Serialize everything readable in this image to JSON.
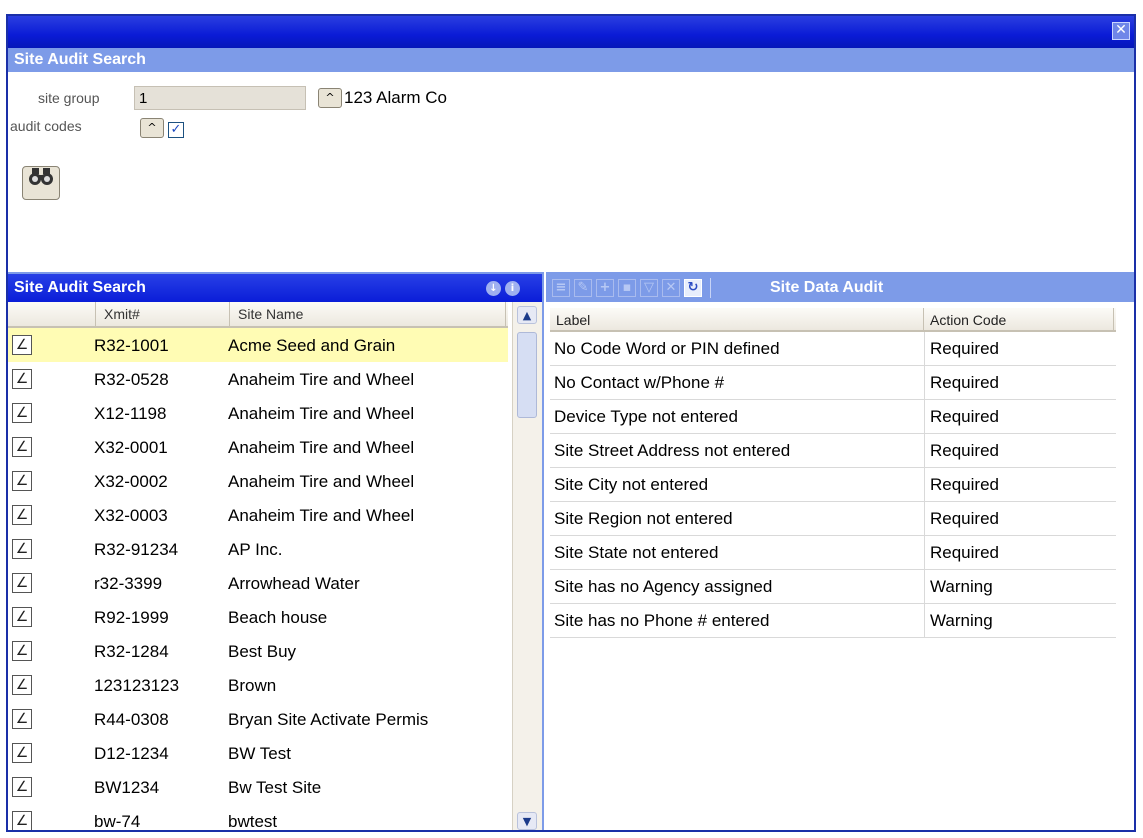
{
  "window": {
    "close_glyph": "✕"
  },
  "search_panel": {
    "title": "Site Audit Search",
    "site_group_label": "site group",
    "site_group_value": "1",
    "site_group_name": "123 Alarm Co",
    "audit_codes_label": "audit codes",
    "audit_codes_checked": true,
    "search_icon": "binoculars-icon",
    "up_glyph": "^"
  },
  "results_panel": {
    "title": "Site Audit Search",
    "columns": [
      "Xmit#",
      "Site Name"
    ],
    "rows": [
      {
        "xmit": "R32-1001",
        "site_name": "Acme Seed and Grain",
        "selected": true
      },
      {
        "xmit": "R32-0528",
        "site_name": "Anaheim Tire and Wheel"
      },
      {
        "xmit": "X12-1198",
        "site_name": "Anaheim Tire and Wheel"
      },
      {
        "xmit": "X32-0001",
        "site_name": "Anaheim Tire and Wheel"
      },
      {
        "xmit": "X32-0002",
        "site_name": "Anaheim Tire and Wheel"
      },
      {
        "xmit": "X32-0003",
        "site_name": "Anaheim Tire and Wheel"
      },
      {
        "xmit": "R32-91234",
        "site_name": "AP Inc."
      },
      {
        "xmit": "r32-3399",
        "site_name": "Arrowhead Water"
      },
      {
        "xmit": "R92-1999",
        "site_name": "Beach house"
      },
      {
        "xmit": "R32-1284",
        "site_name": "Best Buy"
      },
      {
        "xmit": "123123123",
        "site_name": "Brown"
      },
      {
        "xmit": "R44-0308",
        "site_name": "Bryan Site Activate Permis"
      },
      {
        "xmit": "D12-1234",
        "site_name": "BW Test"
      },
      {
        "xmit": "BW1234",
        "site_name": "Bw Test Site"
      },
      {
        "xmit": "bw-74",
        "site_name": "bwtest"
      }
    ]
  },
  "audit_panel": {
    "title": "Site Data Audit",
    "columns": [
      "Label",
      "Action Code"
    ],
    "rows": [
      {
        "label": "No Code Word or PIN defined",
        "action": "Required"
      },
      {
        "label": "No Contact w/Phone #",
        "action": "Required"
      },
      {
        "label": "Device Type not entered",
        "action": "Required"
      },
      {
        "label": "Site Street Address not entered",
        "action": "Required"
      },
      {
        "label": "Site City not entered",
        "action": "Required"
      },
      {
        "label": "Site Region not entered",
        "action": "Required"
      },
      {
        "label": "Site State not entered",
        "action": "Required"
      },
      {
        "label": "Site has no Agency assigned",
        "action": "Warning"
      },
      {
        "label": "Site has no Phone # entered",
        "action": "Warning"
      }
    ]
  },
  "colors": {
    "title_blue": "#0a1bd6",
    "section_blue": "#7d9be8",
    "selected_row": "#fffcb4"
  }
}
